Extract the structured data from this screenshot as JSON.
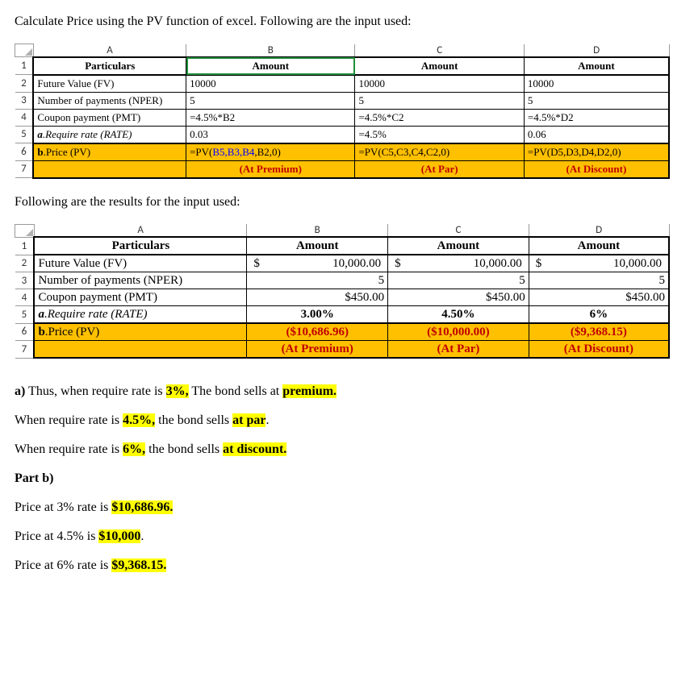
{
  "intro": "Calculate Price using the PV function of excel. Following are the input used:",
  "table1": {
    "cols": [
      "A",
      "B",
      "C",
      "D"
    ],
    "rows": [
      "1",
      "2",
      "3",
      "4",
      "5",
      "6",
      "7"
    ],
    "hdr": {
      "a": "Particulars",
      "b": "Amount",
      "c": "Amount",
      "d": "Amount"
    },
    "r2": {
      "a": "Future Value  (FV)",
      "b": "10000",
      "c": "10000",
      "d": "10000"
    },
    "r3": {
      "a": "Number of payments  (NPER)",
      "b": "5",
      "c": "5",
      "d": "5"
    },
    "r4": {
      "a": "Coupon payment (PMT)",
      "b": "=4.5%*B2",
      "c": "=4.5%*C2",
      "d": "=4.5%*D2"
    },
    "r5": {
      "a_pre": "a",
      "a": ".Require rate  (RATE)",
      "b": "0.03",
      "c": "=4.5%",
      "d": "0.06"
    },
    "r6": {
      "a_pre": "b",
      "a": ".Price (PV)",
      "b_pre": "=PV(",
      "b_arg": "B5,B3,B4",
      "b_post": ",B2,0)",
      "c": "=PV(C5,C3,C4,C2,0)",
      "d": "=PV(D5,D3,D4,D2,0)"
    },
    "r7": {
      "b": "(At Premium)",
      "c": "(At Par)",
      "d": "(At Discount)"
    }
  },
  "mid": "Following are the results for the input used:",
  "table2": {
    "cols": [
      "A",
      "B",
      "C",
      "D"
    ],
    "rows": [
      "1",
      "2",
      "3",
      "4",
      "5",
      "6",
      "7"
    ],
    "hdr": {
      "a": "Particulars",
      "b": "Amount",
      "c": "Amount",
      "d": "Amount"
    },
    "r2": {
      "a": "Future Value  (FV)",
      "b_cur": "$",
      "b": "10,000.00",
      "c_cur": "$",
      "c": "10,000.00",
      "d_cur": "$",
      "d": "10,000.00"
    },
    "r3": {
      "a": "Number of payments  (NPER)",
      "b": "5",
      "c": "5",
      "d": "5"
    },
    "r4": {
      "a": "Coupon payment (PMT)",
      "b": "$450.00",
      "c": "$450.00",
      "d": "$450.00"
    },
    "r5": {
      "a_pre": "a",
      "a": ".Require rate  (RATE)",
      "b": "3.00%",
      "c": "4.50%",
      "d": "6%"
    },
    "r6": {
      "a_pre": "b",
      "a": ".Price (PV)",
      "b": "($10,686.96)",
      "c": "($10,000.00)",
      "d": "($9,368.15)"
    },
    "r7": {
      "b": "(At Premium)",
      "c": "(At Par)",
      "d": "(At Discount)"
    }
  },
  "conc": {
    "l1_a": "a)",
    "l1_b": " Thus, when require rate is ",
    "l1_c": "3%,",
    "l1_d": " The bond sells at ",
    "l1_e": "premium.",
    "l2_a": "When require rate is ",
    "l2_b": "4.5%,",
    "l2_c": " the bond sells ",
    "l2_d": "at par",
    "l2_e": ".",
    "l3_a": "When require rate is ",
    "l3_b": "6%,",
    "l3_c": " the bond sells ",
    "l3_d": "at discount.",
    "pb": "Part b)",
    "p1_a": "Price at 3% rate is ",
    "p1_b": "$10,686.96.",
    "p2_a": "Price at 4.5% is ",
    "p2_b": "$10,000",
    "p2_c": ".",
    "p3_a": "Price at 6% rate is ",
    "p3_b": "$9,368.15."
  }
}
